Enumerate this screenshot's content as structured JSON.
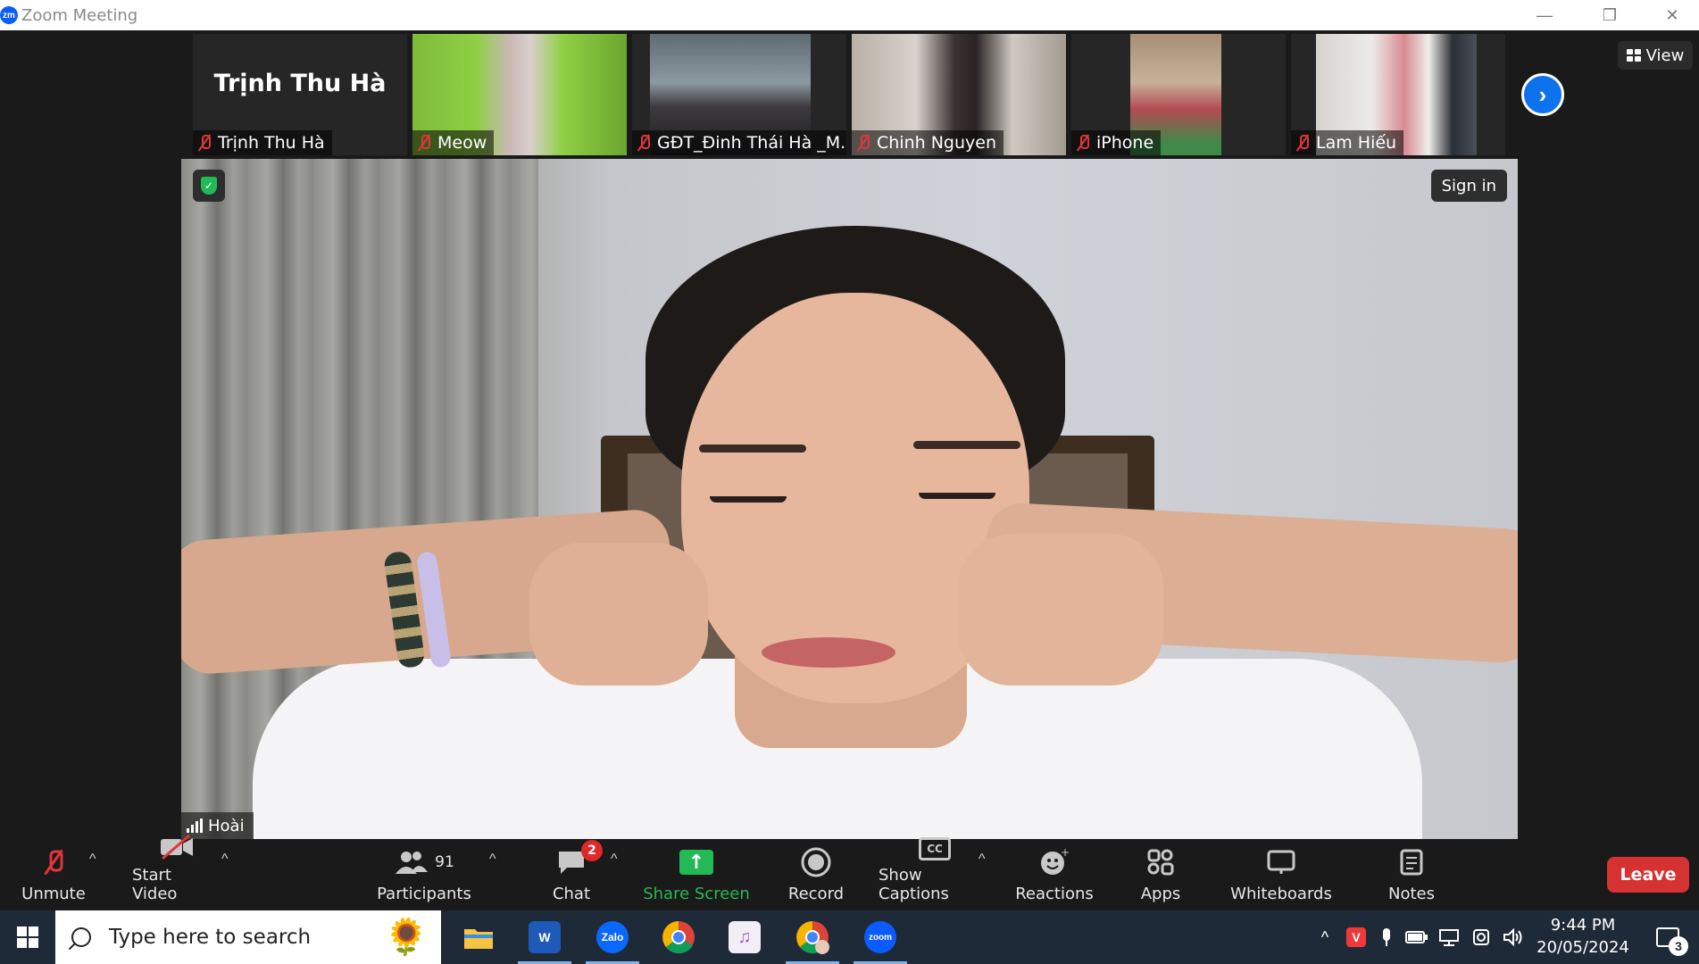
{
  "window": {
    "title": "Zoom Meeting",
    "logo_text": "zm",
    "minimize": "—",
    "restore": "❐",
    "close": "✕"
  },
  "participants_strip": {
    "name_only_tile": "Trịnh Thu Hà",
    "tiles": [
      {
        "name": "Trịnh Thu Hà"
      },
      {
        "name": "Meow"
      },
      {
        "name": "GĐT_Đinh Thái Hà _M..."
      },
      {
        "name": "Chinh Nguyen"
      },
      {
        "name": "iPhone"
      },
      {
        "name": "Lam Hiếu"
      }
    ],
    "next_arrow": "›"
  },
  "view_button": {
    "label": "View"
  },
  "main_video": {
    "speaker_name": "Hoài",
    "sign_in_label": "Sign in",
    "shield_check": "✓"
  },
  "toolbar": {
    "unmute": "Unmute",
    "start_video": "Start Video",
    "participants": "Participants",
    "participants_count": "91",
    "chat": "Chat",
    "chat_badge": "2",
    "share_screen": "Share Screen",
    "record": "Record",
    "show_captions": "Show Captions",
    "cc": "CC",
    "reactions": "Reactions",
    "apps": "Apps",
    "whiteboards": "Whiteboards",
    "notes": "Notes",
    "leave": "Leave",
    "caret": "^",
    "share_arrow": "↑"
  },
  "taskbar": {
    "search_placeholder": "Type here to search",
    "apps": {
      "word": "W",
      "zalo": "Zalo",
      "zoom": "zoom"
    },
    "tray_chevron": "^",
    "time": "9:44 PM",
    "date": "20/05/2024",
    "notification_count": "3"
  },
  "colors": {
    "accent_blue": "#0e72ed",
    "leave_red": "#d63231",
    "share_green": "#23b955",
    "mic_off_red": "#e0353b",
    "taskbar": "#1f2a38"
  }
}
